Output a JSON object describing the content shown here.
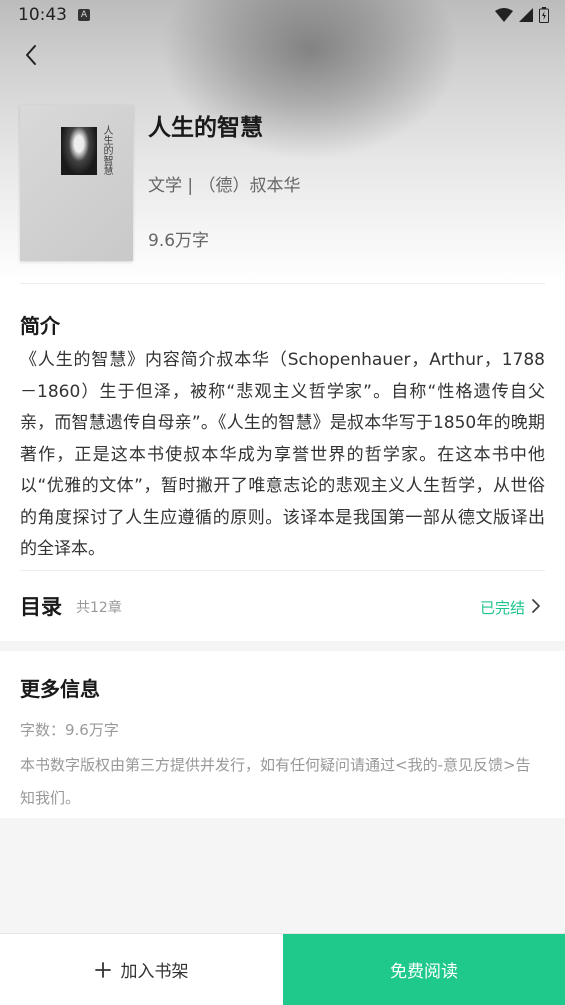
{
  "status_bar": {
    "time": "10:43",
    "notif_letter": "A"
  },
  "colors": {
    "accent": "#1fc98b",
    "completed_text": "#1fc48a"
  },
  "book": {
    "cover_title": "人生的智慧",
    "title": "人生的智慧",
    "meta": "文学 | （德）叔本华",
    "words": "9.6万字"
  },
  "intro": {
    "heading": "简介",
    "text": "《人生的智慧》内容简介叔本华（Schopenhauer，Arthur，1788－1860）生于但泽，被称“悲观主义哲学家”。自称“性格遗传自父亲，而智慧遗传自母亲”。《人生的智慧》是叔本华写于1850年的晚期著作，正是这本书使叔本华成为享誉世界的哲学家。在这本书中他以“优雅的文体”，暂时撇开了唯意志论的悲观主义人生哲学，从世俗的角度探讨了人生应遵循的原则。该译本是我国第一部从德文版译出的全译本。"
  },
  "toc": {
    "heading": "目录",
    "count": "共12章",
    "status": "已完结"
  },
  "more_info": {
    "heading": "更多信息",
    "word_count": "字数：9.6万字",
    "copyright": "本书数字版权由第三方提供并发行，如有任何疑问请通过<我的-意见反馈>告知我们。"
  },
  "actions": {
    "add_to_shelf": "加入书架",
    "read_free": "免费阅读"
  }
}
